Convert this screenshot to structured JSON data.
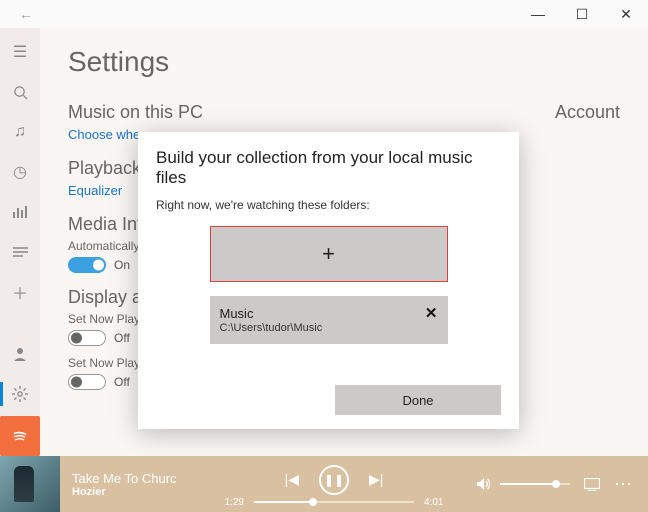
{
  "titlebar": {
    "back": "←",
    "min": "—",
    "max": "☐",
    "close": "✕"
  },
  "page": {
    "title": "Settings",
    "music_on_pc": "Music on this PC",
    "account": "Account",
    "choose_link": "Choose where ",
    "playback": "Playback",
    "equalizer": "Equalizer",
    "media_info": "Media Inf",
    "auto_retrieve": "Automatically re",
    "on": "On",
    "display": "Display an",
    "set_now_playing1": "Set Now Playing",
    "set_now_playing2": "Set Now Playing",
    "off": "Off"
  },
  "dialog": {
    "title": "Build your collection from your local music files",
    "subtitle": "Right now, we're watching these folders:",
    "plus": "+",
    "folder_name": "Music",
    "folder_path": "C:\\Users\\tudor\\Music",
    "close_x": "✕",
    "done": "Done"
  },
  "player": {
    "title": "Take Me To Churc",
    "artist": "Hozier",
    "prev": "|◀",
    "pause": "❚❚",
    "next": "▶|",
    "elapsed": "1:29",
    "total": "4:01",
    "vol_icon": "🔊",
    "cast": "⎚",
    "more": "⋯"
  }
}
